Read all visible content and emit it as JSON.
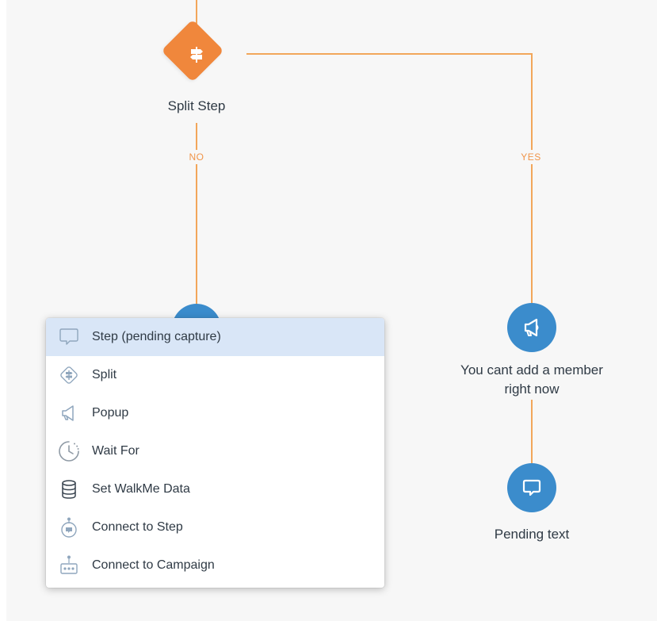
{
  "flow": {
    "split_node": {
      "title": "Split Step",
      "icon": "signpost-icon",
      "color": "#f0873c"
    },
    "branches": {
      "no_label": "NO",
      "yes_label": "YES"
    },
    "popup_node": {
      "title_line1": "You cant add a member",
      "title_line2": "right now",
      "icon": "megaphone-icon"
    },
    "pending_node": {
      "title": "Pending text",
      "icon": "speech-bubble-icon"
    },
    "colors": {
      "connector": "#f2a65a",
      "node_blue": "#3b8ccc",
      "menu_highlight": "#d9e6f7"
    }
  },
  "menu": {
    "items": [
      {
        "label": "Step (pending capture)",
        "icon": "speech-bubble-outline-icon",
        "selected": true
      },
      {
        "label": "Split",
        "icon": "split-diamond-icon",
        "selected": false
      },
      {
        "label": "Popup",
        "icon": "megaphone-outline-icon",
        "selected": false
      },
      {
        "label": "Wait For",
        "icon": "clock-icon",
        "selected": false
      },
      {
        "label": "Set WalkMe Data",
        "icon": "database-icon",
        "selected": false
      },
      {
        "label": "Connect to Step",
        "icon": "connect-step-icon",
        "selected": false
      },
      {
        "label": "Connect to Campaign",
        "icon": "connect-campaign-icon",
        "selected": false
      }
    ]
  }
}
